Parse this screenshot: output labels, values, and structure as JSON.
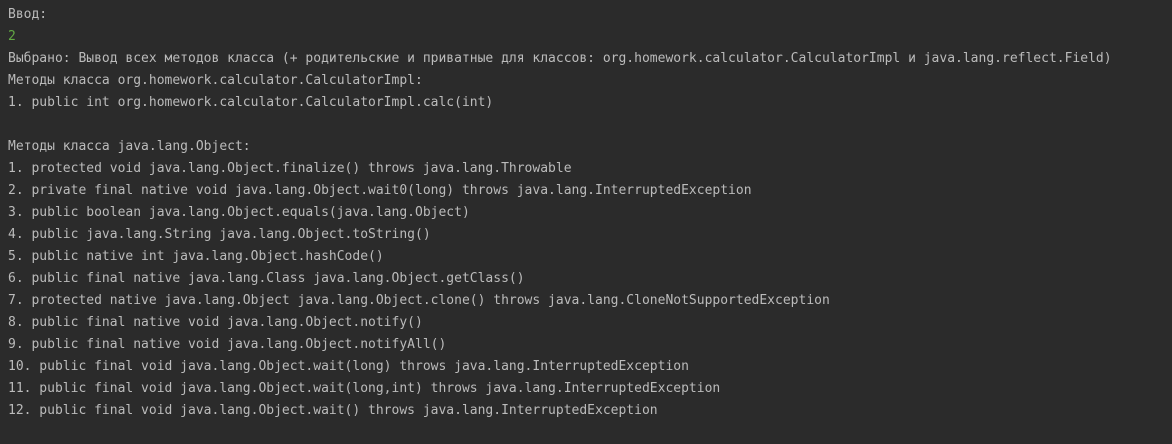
{
  "console": {
    "prompt_label": "Ввод:",
    "user_input": "2",
    "selection_message": "Выбрано: Вывод всех методов класса (+ родительские и приватные для классов: org.homework.calculator.CalculatorImpl и java.lang.reflect.Field)",
    "impl_header": "Методы класса org.homework.calculator.CalculatorImpl:",
    "impl_methods": [
      "1. public int org.homework.calculator.CalculatorImpl.calc(int)"
    ],
    "object_header": "Методы класса java.lang.Object:",
    "object_methods": [
      "1. protected void java.lang.Object.finalize() throws java.lang.Throwable",
      "2. private final native void java.lang.Object.wait0(long) throws java.lang.InterruptedException",
      "3. public boolean java.lang.Object.equals(java.lang.Object)",
      "4. public java.lang.String java.lang.Object.toString()",
      "5. public native int java.lang.Object.hashCode()",
      "6. public final native java.lang.Class java.lang.Object.getClass()",
      "7. protected native java.lang.Object java.lang.Object.clone() throws java.lang.CloneNotSupportedException",
      "8. public final native void java.lang.Object.notify()",
      "9. public final native void java.lang.Object.notifyAll()",
      "10. public final void java.lang.Object.wait(long) throws java.lang.InterruptedException",
      "11. public final void java.lang.Object.wait(long,int) throws java.lang.InterruptedException",
      "12. public final void java.lang.Object.wait() throws java.lang.InterruptedException"
    ]
  },
  "colors": {
    "background": "#2b2b2b",
    "text": "#bbbbbb",
    "user_input": "#62a844"
  }
}
